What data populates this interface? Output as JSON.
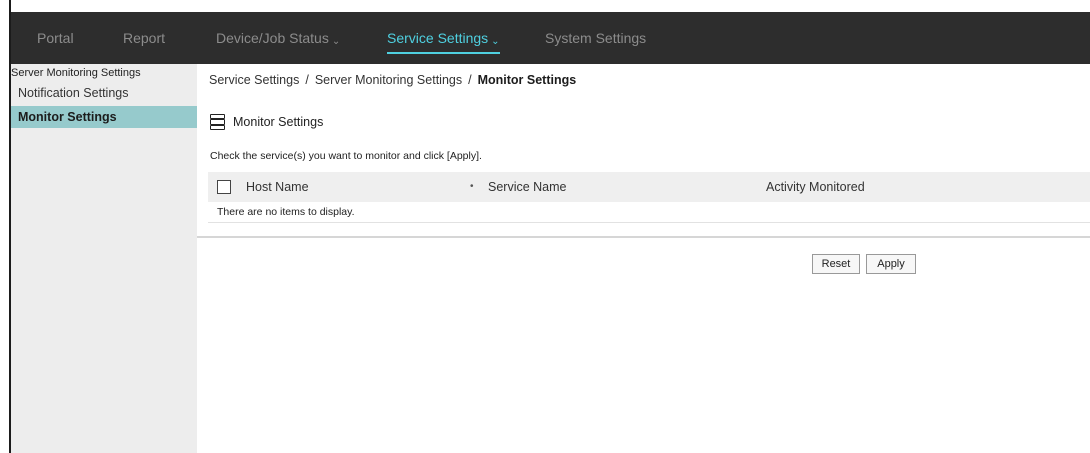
{
  "nav": {
    "items": [
      {
        "label": "Portal"
      },
      {
        "label": "Report"
      },
      {
        "label": "Device/Job Status"
      },
      {
        "label": "Service Settings"
      },
      {
        "label": "System Settings"
      }
    ],
    "active": "Service Settings",
    "colors": {
      "bar": "#2d2d2d",
      "text": "#8c8c8c",
      "active": "#4fd0e0"
    }
  },
  "sidebar": {
    "group_label": "Server Monitoring Settings",
    "items": [
      {
        "label": "Notification Settings"
      },
      {
        "label": "Monitor Settings"
      }
    ],
    "active": "Monitor Settings",
    "colors": {
      "background": "#ededed",
      "active": "#96cacc"
    }
  },
  "breadcrumb": {
    "items": [
      "Service Settings",
      "Server Monitoring Settings",
      "Monitor Settings"
    ],
    "separator": "/"
  },
  "section": {
    "title": "Monitor Settings",
    "icon": "server-icon"
  },
  "instructions": "Check the service(s) you want to monitor and click [Apply].",
  "table": {
    "columns": [
      "Host Name",
      "Service Name",
      "Activity Monitored"
    ],
    "empty_message": "There are no items to display.",
    "rows": []
  },
  "buttons": {
    "reset": "Reset",
    "apply": "Apply"
  }
}
